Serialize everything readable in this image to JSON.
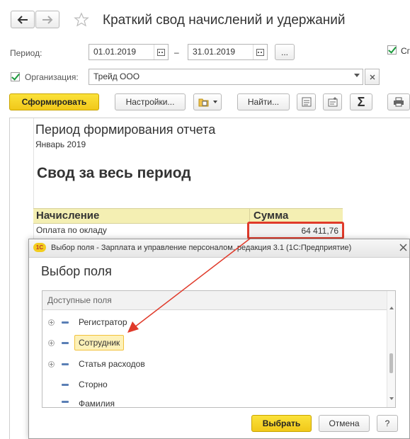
{
  "window": {
    "title": "Краткий свод начислений и удержаний"
  },
  "params": {
    "period_label": "Период:",
    "date_from": "01.01.2019",
    "dash": "–",
    "date_to": "31.01.2019",
    "dots": "...",
    "org_label": "Организация:",
    "org_value": "Трейд ООО",
    "right_check_label": "Сг"
  },
  "toolbar": {
    "generate": "Сформировать",
    "settings": "Настройки...",
    "find": "Найти..."
  },
  "report": {
    "period_title": "Период формирования отчета",
    "period_value": "Январь 2019",
    "heading": "Свод за весь период",
    "col_accrual": "Начисление",
    "col_sum": "Сумма",
    "row_label": "Оплата по окладу",
    "row_sum": "64 411,76"
  },
  "dialog": {
    "title": "Выбор поля - Зарплата и управление персоналом, редакция 3.1  (1С:Предприятие)",
    "logo": "1С",
    "heading": "Выбор поля",
    "list_header": "Доступные поля",
    "items": [
      {
        "label": "Регистратор",
        "expandable": true
      },
      {
        "label": "Сотрудник",
        "expandable": true,
        "selected": true
      },
      {
        "label": "Статья расходов",
        "expandable": true
      },
      {
        "label": "Сторно",
        "expandable": false
      },
      {
        "label": "Фамилия",
        "expandable": false
      }
    ],
    "select_button": "Выбрать",
    "cancel_button": "Отмена",
    "help_button": "?"
  },
  "colors": {
    "accent_yellow": "#f3cd1e",
    "highlight_red": "#e03a2a",
    "header_band": "#f4efb3"
  }
}
